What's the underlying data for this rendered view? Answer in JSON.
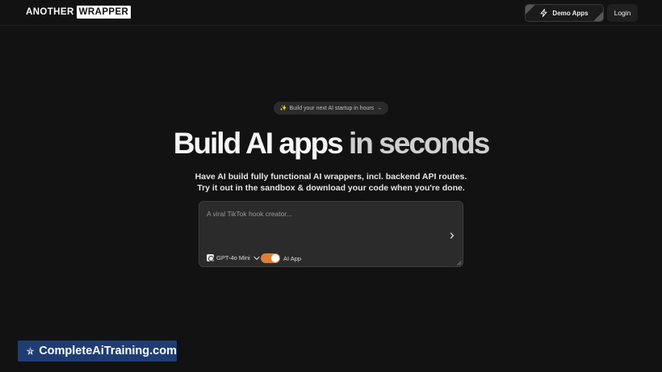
{
  "header": {
    "logo_part1": "ANOTHER",
    "logo_part2": "WRAPPER",
    "demo_apps_label": "Demo Apps",
    "demo_apps_icon": "lightning-icon",
    "login_label": "Login"
  },
  "hero": {
    "pill_icon": "✨",
    "pill_text": "Build your next AI startup in hours",
    "pill_arrow": "→",
    "title_part1": "Build AI apps",
    "title_part2": "in seconds",
    "subtitle": "Have AI build fully functional AI wrappers, incl. backend API routes. Try it out in the sandbox & download your code when you're done."
  },
  "prompt": {
    "placeholder": "A viral TikTok hook creator...",
    "value": "",
    "model_label": "GPT-4o Mini",
    "model_icon": "openai-icon",
    "toggle_label": "AI App",
    "toggle_on": true,
    "send_icon": "chevron-right-icon"
  },
  "watermark": {
    "text": "CompleteAiTraining.com"
  },
  "colors": {
    "background": "#121212",
    "toggle_accent": "#e07e35",
    "watermark_bg": "#1f3d73"
  }
}
